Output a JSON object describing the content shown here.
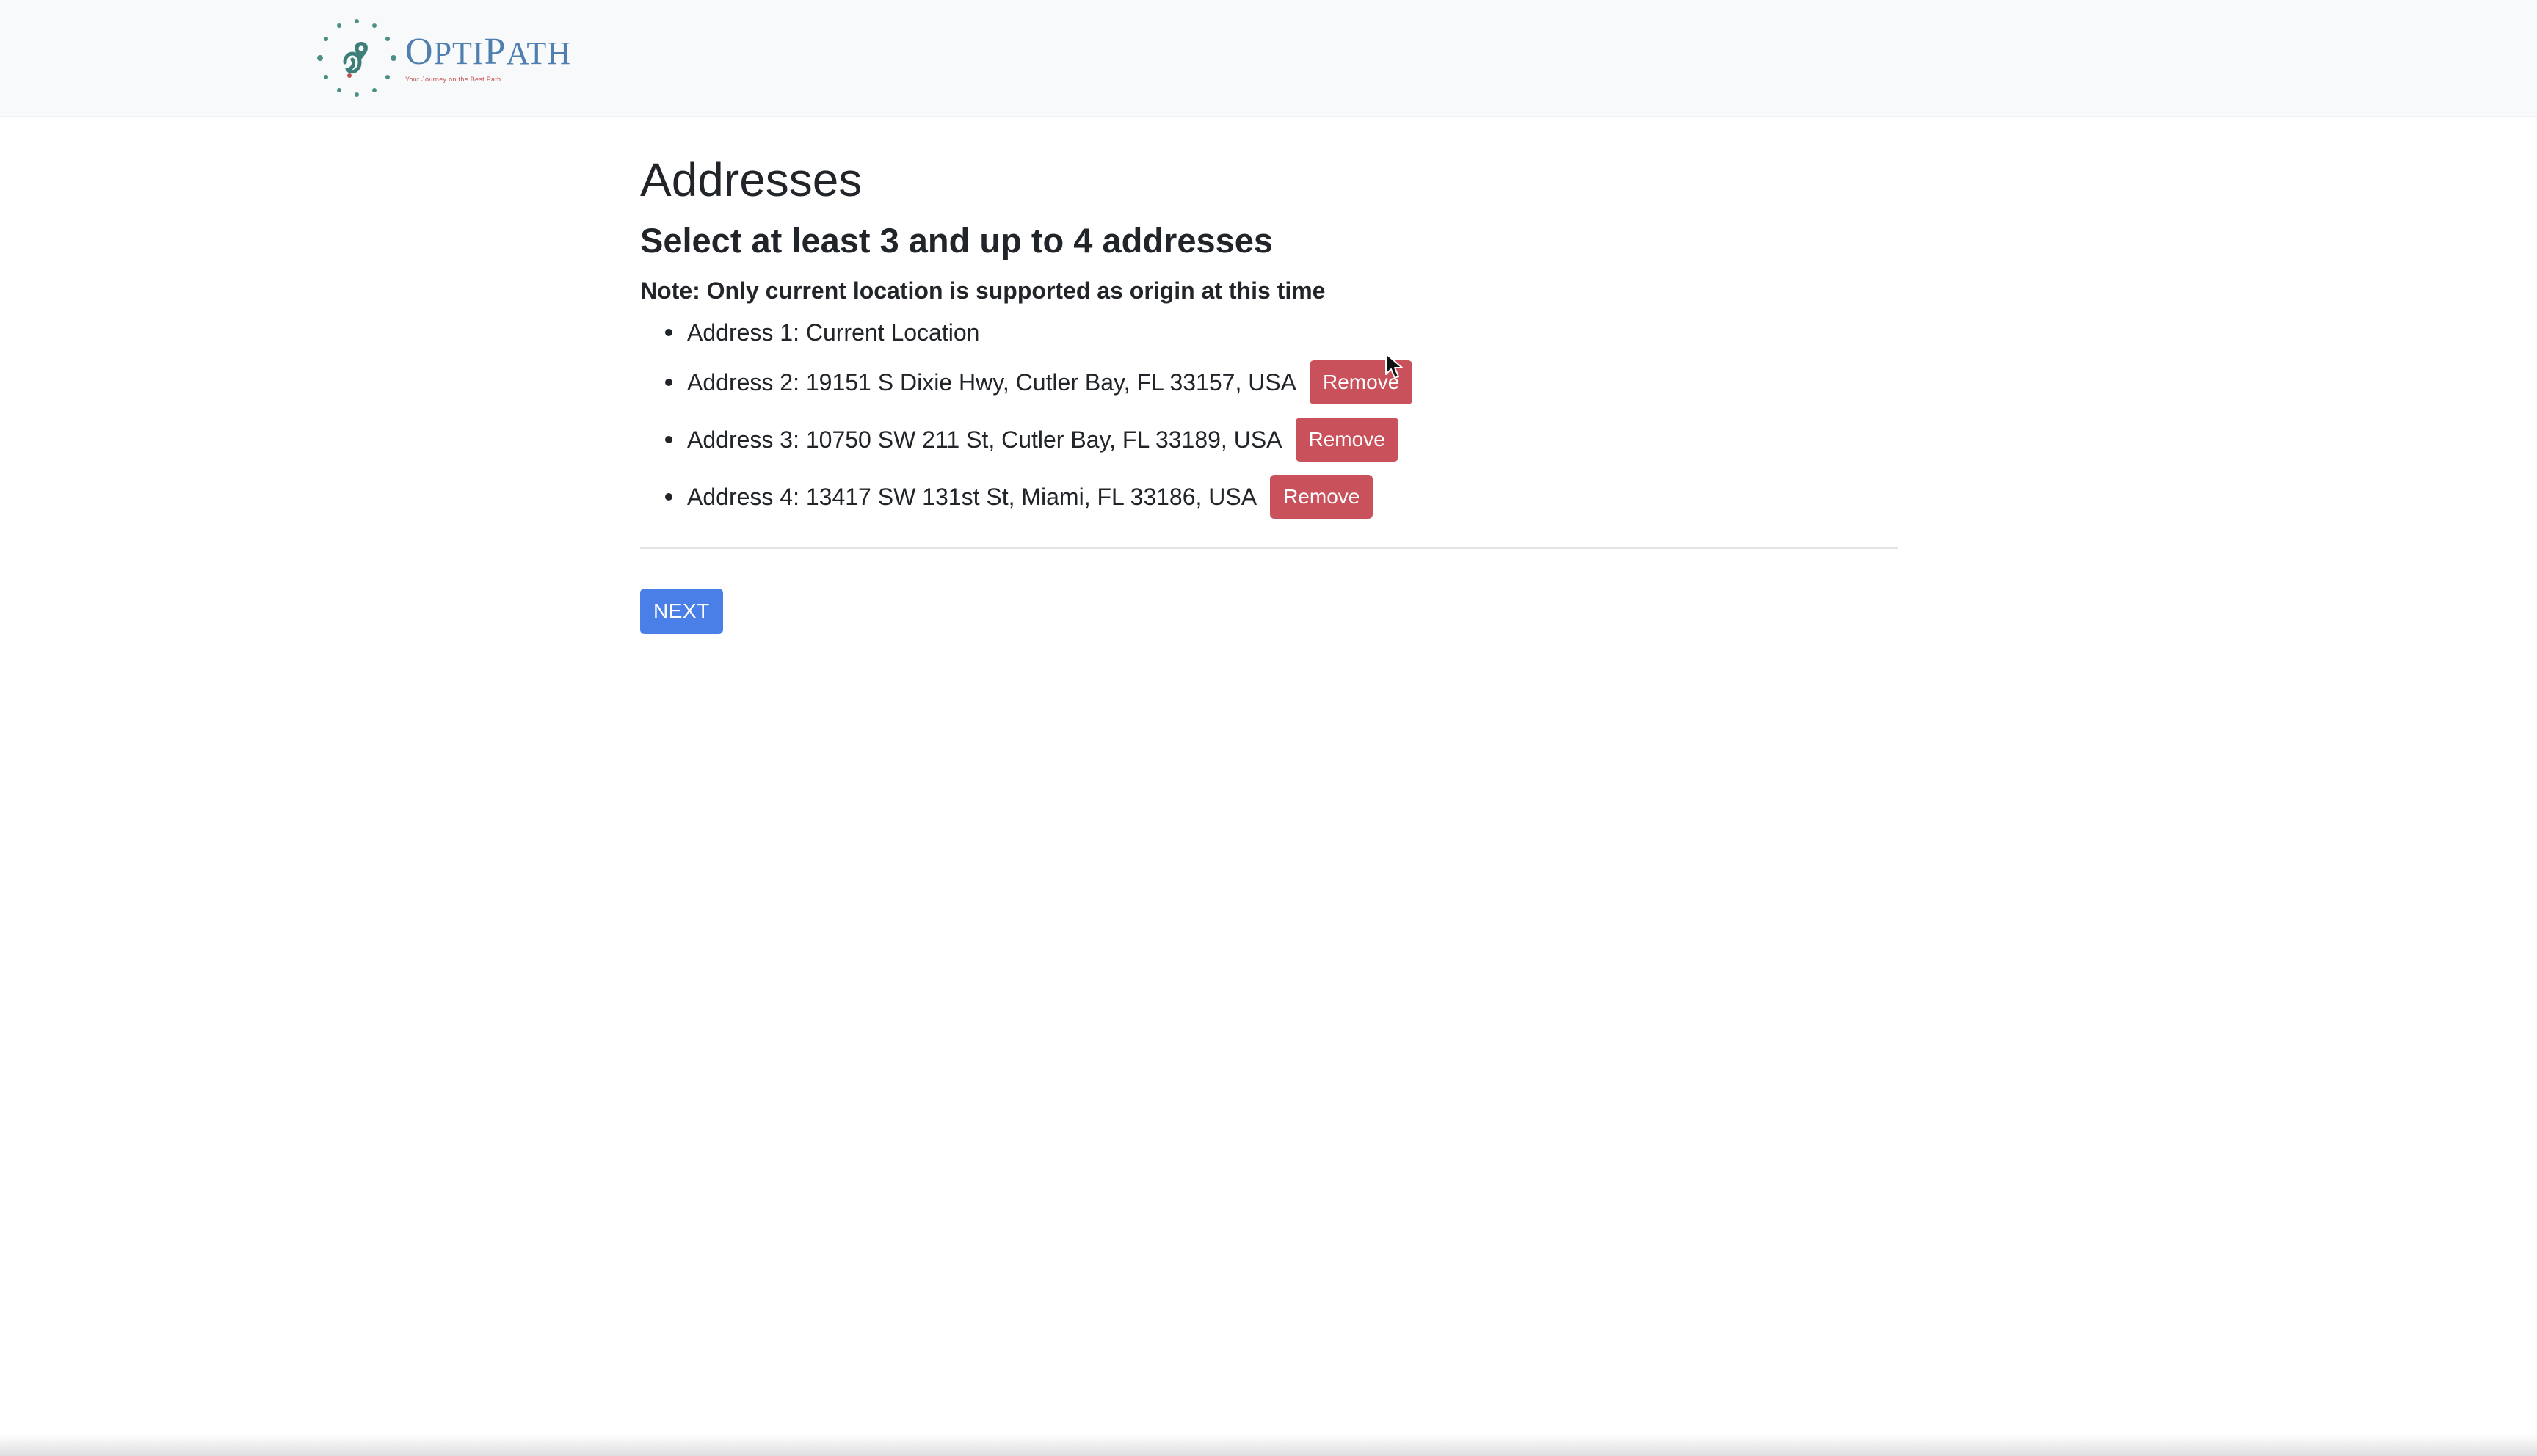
{
  "brand": {
    "name": "OptiPath",
    "name_first": "O",
    "name_rest_1": "PTI",
    "name_mid": "P",
    "name_rest_2": "ATH",
    "tagline": "Your Journey on the Best Path",
    "logo_icon": "route-pin-logo-icon",
    "accent_color": "#4f7fae"
  },
  "main": {
    "title": "Addresses",
    "subtitle": "Select at least 3 and up to 4 addresses",
    "note": "Note: Only current location is supported as origin at this time",
    "addresses": [
      {
        "label": "Address 1: Current Location",
        "removable": false
      },
      {
        "label": "Address 2: 19151 S Dixie Hwy, Cutler Bay, FL 33157, USA",
        "removable": true
      },
      {
        "label": "Address 3: 10750 SW 211 St, Cutler Bay, FL 33189, USA",
        "removable": true
      },
      {
        "label": "Address 4: 13417 SW 131st St, Miami, FL 33186, USA",
        "removable": true
      }
    ],
    "remove_label": "Remove",
    "remove_color": "#c9515c",
    "next_label": "NEXT",
    "next_color": "#4a7fe8"
  }
}
